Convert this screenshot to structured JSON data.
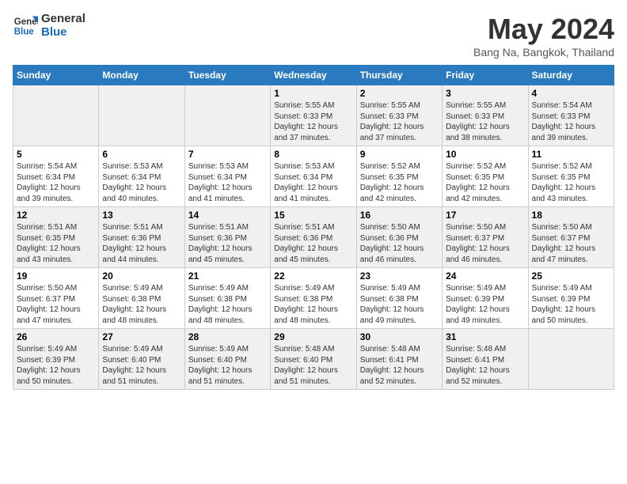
{
  "header": {
    "logo_line1": "General",
    "logo_line2": "Blue",
    "month": "May 2024",
    "location": "Bang Na, Bangkok, Thailand"
  },
  "weekdays": [
    "Sunday",
    "Monday",
    "Tuesday",
    "Wednesday",
    "Thursday",
    "Friday",
    "Saturday"
  ],
  "weeks": [
    [
      {
        "day": "",
        "sunrise": "",
        "sunset": "",
        "daylight": ""
      },
      {
        "day": "",
        "sunrise": "",
        "sunset": "",
        "daylight": ""
      },
      {
        "day": "",
        "sunrise": "",
        "sunset": "",
        "daylight": ""
      },
      {
        "day": "1",
        "sunrise": "Sunrise: 5:55 AM",
        "sunset": "Sunset: 6:33 PM",
        "daylight": "Daylight: 12 hours and 37 minutes."
      },
      {
        "day": "2",
        "sunrise": "Sunrise: 5:55 AM",
        "sunset": "Sunset: 6:33 PM",
        "daylight": "Daylight: 12 hours and 37 minutes."
      },
      {
        "day": "3",
        "sunrise": "Sunrise: 5:55 AM",
        "sunset": "Sunset: 6:33 PM",
        "daylight": "Daylight: 12 hours and 38 minutes."
      },
      {
        "day": "4",
        "sunrise": "Sunrise: 5:54 AM",
        "sunset": "Sunset: 6:33 PM",
        "daylight": "Daylight: 12 hours and 39 minutes."
      }
    ],
    [
      {
        "day": "5",
        "sunrise": "Sunrise: 5:54 AM",
        "sunset": "Sunset: 6:34 PM",
        "daylight": "Daylight: 12 hours and 39 minutes."
      },
      {
        "day": "6",
        "sunrise": "Sunrise: 5:53 AM",
        "sunset": "Sunset: 6:34 PM",
        "daylight": "Daylight: 12 hours and 40 minutes."
      },
      {
        "day": "7",
        "sunrise": "Sunrise: 5:53 AM",
        "sunset": "Sunset: 6:34 PM",
        "daylight": "Daylight: 12 hours and 41 minutes."
      },
      {
        "day": "8",
        "sunrise": "Sunrise: 5:53 AM",
        "sunset": "Sunset: 6:34 PM",
        "daylight": "Daylight: 12 hours and 41 minutes."
      },
      {
        "day": "9",
        "sunrise": "Sunrise: 5:52 AM",
        "sunset": "Sunset: 6:35 PM",
        "daylight": "Daylight: 12 hours and 42 minutes."
      },
      {
        "day": "10",
        "sunrise": "Sunrise: 5:52 AM",
        "sunset": "Sunset: 6:35 PM",
        "daylight": "Daylight: 12 hours and 42 minutes."
      },
      {
        "day": "11",
        "sunrise": "Sunrise: 5:52 AM",
        "sunset": "Sunset: 6:35 PM",
        "daylight": "Daylight: 12 hours and 43 minutes."
      }
    ],
    [
      {
        "day": "12",
        "sunrise": "Sunrise: 5:51 AM",
        "sunset": "Sunset: 6:35 PM",
        "daylight": "Daylight: 12 hours and 43 minutes."
      },
      {
        "day": "13",
        "sunrise": "Sunrise: 5:51 AM",
        "sunset": "Sunset: 6:36 PM",
        "daylight": "Daylight: 12 hours and 44 minutes."
      },
      {
        "day": "14",
        "sunrise": "Sunrise: 5:51 AM",
        "sunset": "Sunset: 6:36 PM",
        "daylight": "Daylight: 12 hours and 45 minutes."
      },
      {
        "day": "15",
        "sunrise": "Sunrise: 5:51 AM",
        "sunset": "Sunset: 6:36 PM",
        "daylight": "Daylight: 12 hours and 45 minutes."
      },
      {
        "day": "16",
        "sunrise": "Sunrise: 5:50 AM",
        "sunset": "Sunset: 6:36 PM",
        "daylight": "Daylight: 12 hours and 46 minutes."
      },
      {
        "day": "17",
        "sunrise": "Sunrise: 5:50 AM",
        "sunset": "Sunset: 6:37 PM",
        "daylight": "Daylight: 12 hours and 46 minutes."
      },
      {
        "day": "18",
        "sunrise": "Sunrise: 5:50 AM",
        "sunset": "Sunset: 6:37 PM",
        "daylight": "Daylight: 12 hours and 47 minutes."
      }
    ],
    [
      {
        "day": "19",
        "sunrise": "Sunrise: 5:50 AM",
        "sunset": "Sunset: 6:37 PM",
        "daylight": "Daylight: 12 hours and 47 minutes."
      },
      {
        "day": "20",
        "sunrise": "Sunrise: 5:49 AM",
        "sunset": "Sunset: 6:38 PM",
        "daylight": "Daylight: 12 hours and 48 minutes."
      },
      {
        "day": "21",
        "sunrise": "Sunrise: 5:49 AM",
        "sunset": "Sunset: 6:38 PM",
        "daylight": "Daylight: 12 hours and 48 minutes."
      },
      {
        "day": "22",
        "sunrise": "Sunrise: 5:49 AM",
        "sunset": "Sunset: 6:38 PM",
        "daylight": "Daylight: 12 hours and 48 minutes."
      },
      {
        "day": "23",
        "sunrise": "Sunrise: 5:49 AM",
        "sunset": "Sunset: 6:38 PM",
        "daylight": "Daylight: 12 hours and 49 minutes."
      },
      {
        "day": "24",
        "sunrise": "Sunrise: 5:49 AM",
        "sunset": "Sunset: 6:39 PM",
        "daylight": "Daylight: 12 hours and 49 minutes."
      },
      {
        "day": "25",
        "sunrise": "Sunrise: 5:49 AM",
        "sunset": "Sunset: 6:39 PM",
        "daylight": "Daylight: 12 hours and 50 minutes."
      }
    ],
    [
      {
        "day": "26",
        "sunrise": "Sunrise: 5:49 AM",
        "sunset": "Sunset: 6:39 PM",
        "daylight": "Daylight: 12 hours and 50 minutes."
      },
      {
        "day": "27",
        "sunrise": "Sunrise: 5:49 AM",
        "sunset": "Sunset: 6:40 PM",
        "daylight": "Daylight: 12 hours and 51 minutes."
      },
      {
        "day": "28",
        "sunrise": "Sunrise: 5:49 AM",
        "sunset": "Sunset: 6:40 PM",
        "daylight": "Daylight: 12 hours and 51 minutes."
      },
      {
        "day": "29",
        "sunrise": "Sunrise: 5:48 AM",
        "sunset": "Sunset: 6:40 PM",
        "daylight": "Daylight: 12 hours and 51 minutes."
      },
      {
        "day": "30",
        "sunrise": "Sunrise: 5:48 AM",
        "sunset": "Sunset: 6:41 PM",
        "daylight": "Daylight: 12 hours and 52 minutes."
      },
      {
        "day": "31",
        "sunrise": "Sunrise: 5:48 AM",
        "sunset": "Sunset: 6:41 PM",
        "daylight": "Daylight: 12 hours and 52 minutes."
      },
      {
        "day": "",
        "sunrise": "",
        "sunset": "",
        "daylight": ""
      }
    ]
  ]
}
